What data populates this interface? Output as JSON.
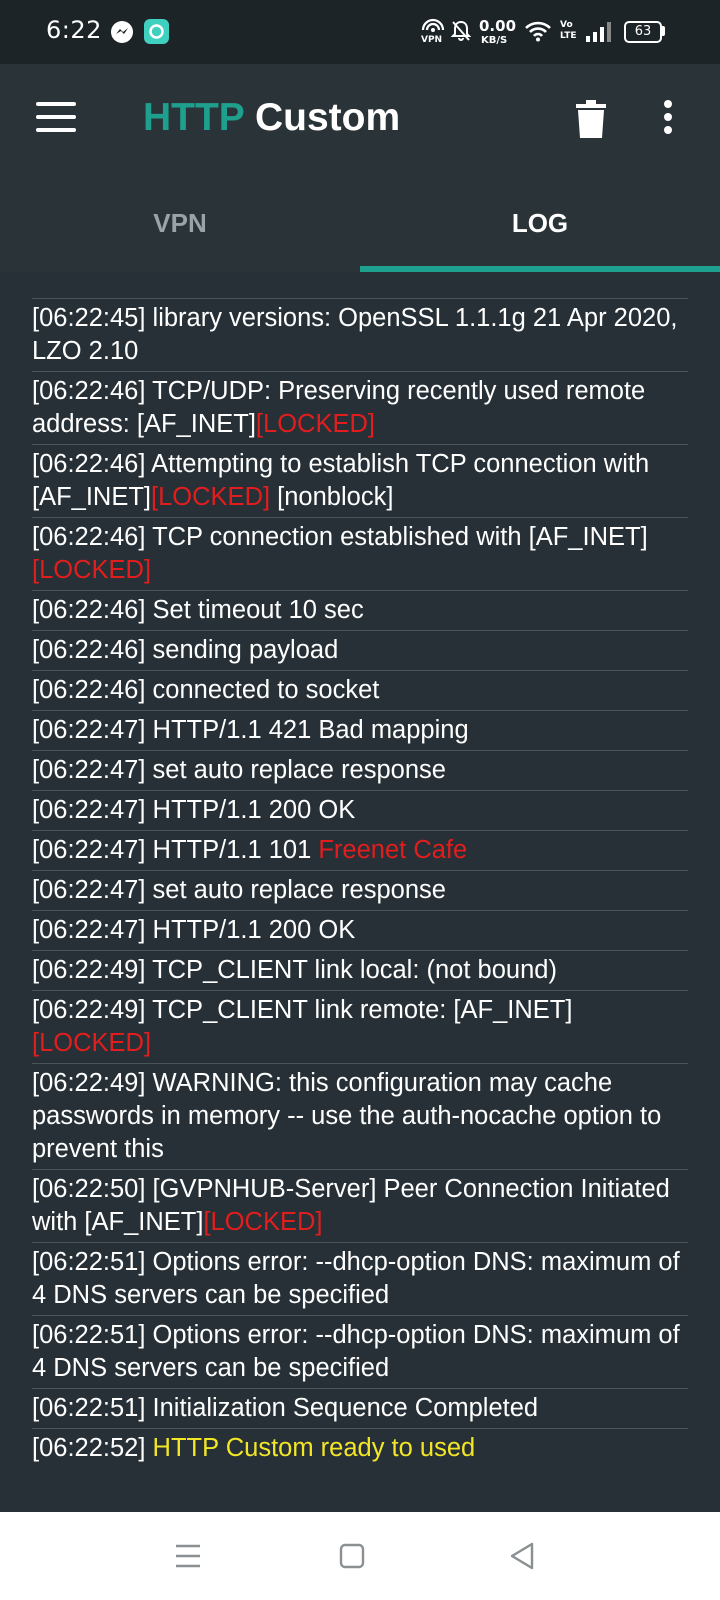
{
  "status_bar": {
    "time": "6:22",
    "net_speed_value": "0.00",
    "net_speed_unit": "KB/S",
    "battery": "63",
    "vpn_label": "VPN",
    "volte_label": "Vo LTE"
  },
  "app_bar": {
    "title_part1": "HTTP",
    "title_part2": "Custom"
  },
  "tabs": [
    {
      "label": "VPN",
      "active": false
    },
    {
      "label": "LOG",
      "active": true
    }
  ],
  "colors": {
    "accent": "#1fa08e",
    "locked_red": "#e11d1d",
    "ready_yellow": "#f2e627",
    "background": "#263036"
  },
  "log": [
    {
      "time": "[06:22:45]",
      "text": "library versions: OpenSSL 1.1.1g 21 Apr 2020, LZO 2.10"
    },
    {
      "time": "[06:22:46]",
      "text": "TCP/UDP: Preserving recently used remote address: [AF_INET]",
      "red": "[LOCKED]"
    },
    {
      "time": "[06:22:46]",
      "text": "Attempting to establish TCP connection with [AF_INET]",
      "red": "[LOCKED]",
      "after": " [nonblock]"
    },
    {
      "time": "[06:22:46]",
      "text": "TCP connection established with [AF_INET]",
      "red": "[LOCKED]"
    },
    {
      "time": "[06:22:46]",
      "text": "Set timeout 10 sec"
    },
    {
      "time": "[06:22:46]",
      "text": "sending payload"
    },
    {
      "time": "[06:22:46]",
      "text": "connected to socket"
    },
    {
      "time": "[06:22:47]",
      "text": "HTTP/1.1 421 Bad mapping"
    },
    {
      "time": "[06:22:47]",
      "text": "set auto replace response"
    },
    {
      "time": "[06:22:47]",
      "text": "HTTP/1.1 200 OK"
    },
    {
      "time": "[06:22:47]",
      "text": "HTTP/1.1 101 ",
      "red": "Freenet Cafe"
    },
    {
      "time": "[06:22:47]",
      "text": "set auto replace response"
    },
    {
      "time": "[06:22:47]",
      "text": "HTTP/1.1 200 OK"
    },
    {
      "time": "[06:22:49]",
      "text": "TCP_CLIENT link local: (not bound)"
    },
    {
      "time": "[06:22:49]",
      "text": "TCP_CLIENT link remote: [AF_INET]",
      "red": "[LOCKED]"
    },
    {
      "time": "[06:22:49]",
      "text": "WARNING: this configuration may cache passwords in memory -- use the auth-nocache option to prevent this"
    },
    {
      "time": "[06:22:50]",
      "text": "[GVPNHUB-Server] Peer Connection Initiated with [AF_INET]",
      "red": "[LOCKED]"
    },
    {
      "time": "[06:22:51]",
      "text": "Options error: --dhcp-option DNS: maximum of 4 DNS servers can be specified"
    },
    {
      "time": "[06:22:51]",
      "text": "Options error: --dhcp-option DNS: maximum of 4 DNS servers can be specified"
    },
    {
      "time": "[06:22:51]",
      "text": "Initialization Sequence Completed"
    },
    {
      "time": "[06:22:52]",
      "text": "",
      "yellow": "HTTP Custom ready to used"
    }
  ]
}
